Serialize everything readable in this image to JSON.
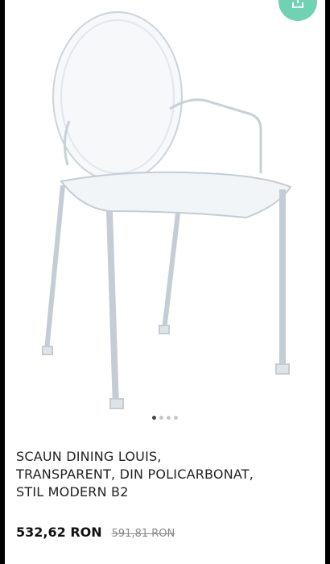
{
  "product": {
    "title_lines": [
      "SCAUN DINING LOUIS,",
      "TRANSPARENT, DIN POLICARBONAT,",
      "STIL MODERN B2"
    ],
    "price": "532,62 RON",
    "old_price": "591,81 RON"
  },
  "gallery": {
    "image_count": 4,
    "active_index": 0
  },
  "colors": {
    "share_button": "#6fd3b3",
    "dot_active": "#444444",
    "dot_inactive": "#c8c8c8"
  },
  "icons": {
    "share": "share-icon"
  }
}
